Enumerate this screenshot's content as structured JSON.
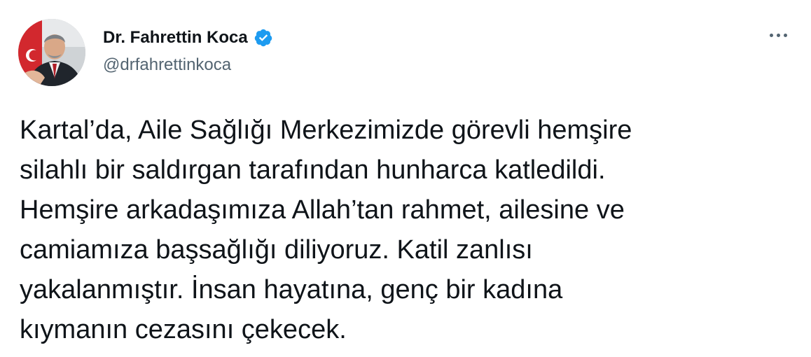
{
  "author": {
    "display_name": "Dr. Fahrettin Koca",
    "handle": "@drfahrettinkoca",
    "verified": true,
    "verified_color": "#1d9bf0",
    "avatar_icon": "profile-photo"
  },
  "menu": {
    "icon": "more-horizontal-icon"
  },
  "tweet": {
    "lines": [
      "Kartal’da, Aile Sağlığı Merkezimizde görevli hemşire",
      "silahlı bir saldırgan tarafından hunharca katledildi.",
      "Hemşire arkadaşımıza Allah’tan rahmet, ailesine ve",
      "camiamıza başsağlığı diliyoruz. Katil zanlısı",
      "yakalanmıştır. İnsan hayatına, genç bir kadına",
      "kıymanın cezasını çekecek."
    ]
  },
  "colors": {
    "text_primary": "#0f1419",
    "text_secondary": "#536471",
    "background": "#ffffff"
  }
}
